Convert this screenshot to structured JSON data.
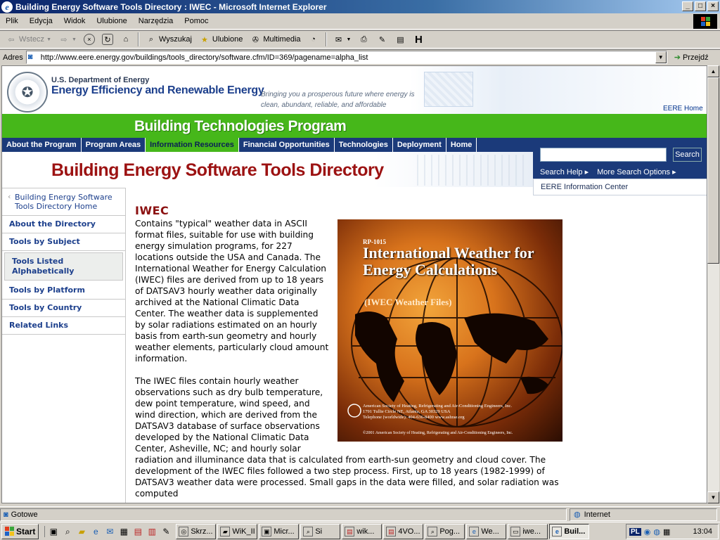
{
  "window": {
    "title": "Building Energy Software Tools Directory : IWEC - Microsoft Internet Explorer",
    "buttons": [
      "_",
      "□",
      "×"
    ]
  },
  "menu": [
    "Plik",
    "Edycja",
    "Widok",
    "Ulubione",
    "Narzędzia",
    "Pomoc"
  ],
  "toolbar": {
    "back": "Wstecz",
    "search": "Wyszukaj",
    "favorites": "Ulubione",
    "media": "Multimedia"
  },
  "address": {
    "label": "Adres",
    "url": "http://www.eere.energy.gov/buildings/tools_directory/software.cfm/ID=369/pagename=alpha_list",
    "go": "Przejdź"
  },
  "header": {
    "doe": "U.S. Department of Energy",
    "eere": "Energy Efficiency and Renewable Energy",
    "tagline": "Bringing you a prosperous future where energy is clean, abundant, reliable, and affordable",
    "eere_home": "EERE Home",
    "program": "Building Technologies Program"
  },
  "nav": [
    "About the Program",
    "Program Areas",
    "Information Resources",
    "Financial Opportunities",
    "Technologies",
    "Deployment",
    "Home"
  ],
  "search": {
    "button": "Search",
    "help": "Search Help ▸",
    "more": "More Search Options ▸",
    "info_center": "EERE Information Center"
  },
  "directory_title": "Building Energy Software Tools Directory",
  "sidebar": {
    "home": "Building Energy Software Tools Directory Home",
    "items": [
      "About the Directory",
      "Tools by Subject",
      "Tools Listed Alphabetically",
      "Tools by Platform",
      "Tools by Country",
      "Related Links"
    ]
  },
  "article": {
    "heading": "IWEC",
    "p1": "Contains \"typical\" weather data in ASCII format files, suitable for use with building energy simulation programs, for 227 locations outside the USA and Canada. The International Weather for Energy Calculation (IWEC) files are derived from up to 18 years of DATSAV3 hourly weather data originally archived at the National Climatic Data Center. The weather data is supplemented by solar radiations estimated on an hourly basis from earth-sun geometry and hourly weather elements, particularly cloud amount information.",
    "p2": "The IWEC files contain hourly weather observations such as dry bulb temperature, dew point temperature, wind speed, and wind direction, which are derived from the DATSAV3 database of surface observations developed by the National Climatic Data Center, Asheville, NC; and hourly solar radiation and illuminance data that is calculated from earth-sun geometry and cloud cover. The development of the IWEC files followed a two step process. First, up to 18 years (1982-1999) of DATSAV3 weather data were processed. Small gaps in the data were filled, and solar radiation was computed"
  },
  "cover": {
    "code": "RP-1015",
    "title": "International Weather for Energy Calculations",
    "subtitle": "(IWEC Weather Files)",
    "publisher": "American Society of Heating, Refrigerating and Air-Conditioning Engineers, Inc.",
    "address": "1791 Tullie Circle NE, Atlanta, GA 30329 USA",
    "phone": "Telephone (worldwide): 404-636-8400 www.ashrae.org",
    "copyright": "©2001 American Society of Heating, Refrigerating and Air-Conditioning Engineers, Inc."
  },
  "status": {
    "text": "Gotowe",
    "zone": "Internet"
  },
  "taskbar": {
    "start": "Start",
    "tasks": [
      "Skrz...",
      "WiK_II",
      "Micr...",
      "Si",
      "wik...",
      "4VO...",
      "Pog...",
      "We...",
      "iwe...",
      "Buil..."
    ],
    "lang": "PL",
    "clock": "13:04"
  },
  "colors": {
    "title_gradient_start": "#0a246a",
    "program_green": "#46b71a",
    "nav_blue": "#1b3a7a",
    "heading_red": "#9c1212"
  }
}
